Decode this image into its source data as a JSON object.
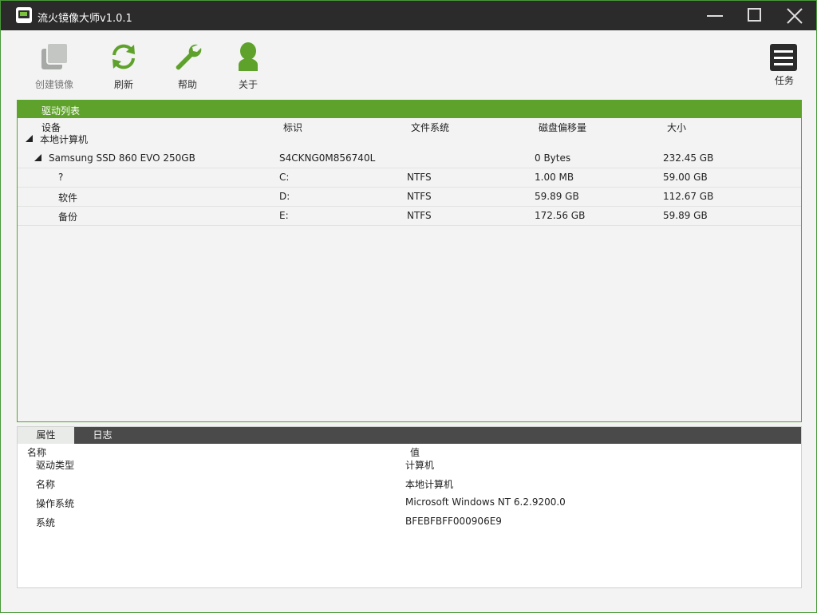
{
  "window": {
    "title": "流火镜像大师v1.0.1",
    "accent": "#5fa22b"
  },
  "toolbar": {
    "create_image": "创建镜像",
    "refresh": "刷新",
    "help": "帮助",
    "about": "关于",
    "tasks": "任务"
  },
  "drive_list": {
    "title": "驱动列表",
    "columns": [
      "设备",
      "标识",
      "文件系统",
      "磁盘偏移量",
      "大小"
    ],
    "root": "本地计算机",
    "disk": {
      "name": "Samsung SSD 860 EVO 250GB",
      "id": "S4CKNG0M856740L",
      "fs": "",
      "offset": "0 Bytes",
      "size": "232.45 GB"
    },
    "partitions": [
      {
        "name": "?",
        "id": "C:",
        "fs": "NTFS",
        "offset": "1.00 MB",
        "size": "59.00 GB"
      },
      {
        "name": "软件",
        "id": "D:",
        "fs": "NTFS",
        "offset": "59.89 GB",
        "size": "112.67 GB"
      },
      {
        "name": "备份",
        "id": "E:",
        "fs": "NTFS",
        "offset": "172.56 GB",
        "size": "59.89 GB"
      }
    ]
  },
  "bottom": {
    "tabs": [
      "属性",
      "日志"
    ],
    "columns": [
      "名称",
      "值"
    ],
    "properties": [
      {
        "key": "驱动类型",
        "value": "计算机"
      },
      {
        "key": "名称",
        "value": "本地计算机"
      },
      {
        "key": "操作系统",
        "value": "Microsoft Windows NT 6.2.9200.0"
      },
      {
        "key": "系统",
        "value": "BFEBFBFF000906E9"
      }
    ]
  }
}
